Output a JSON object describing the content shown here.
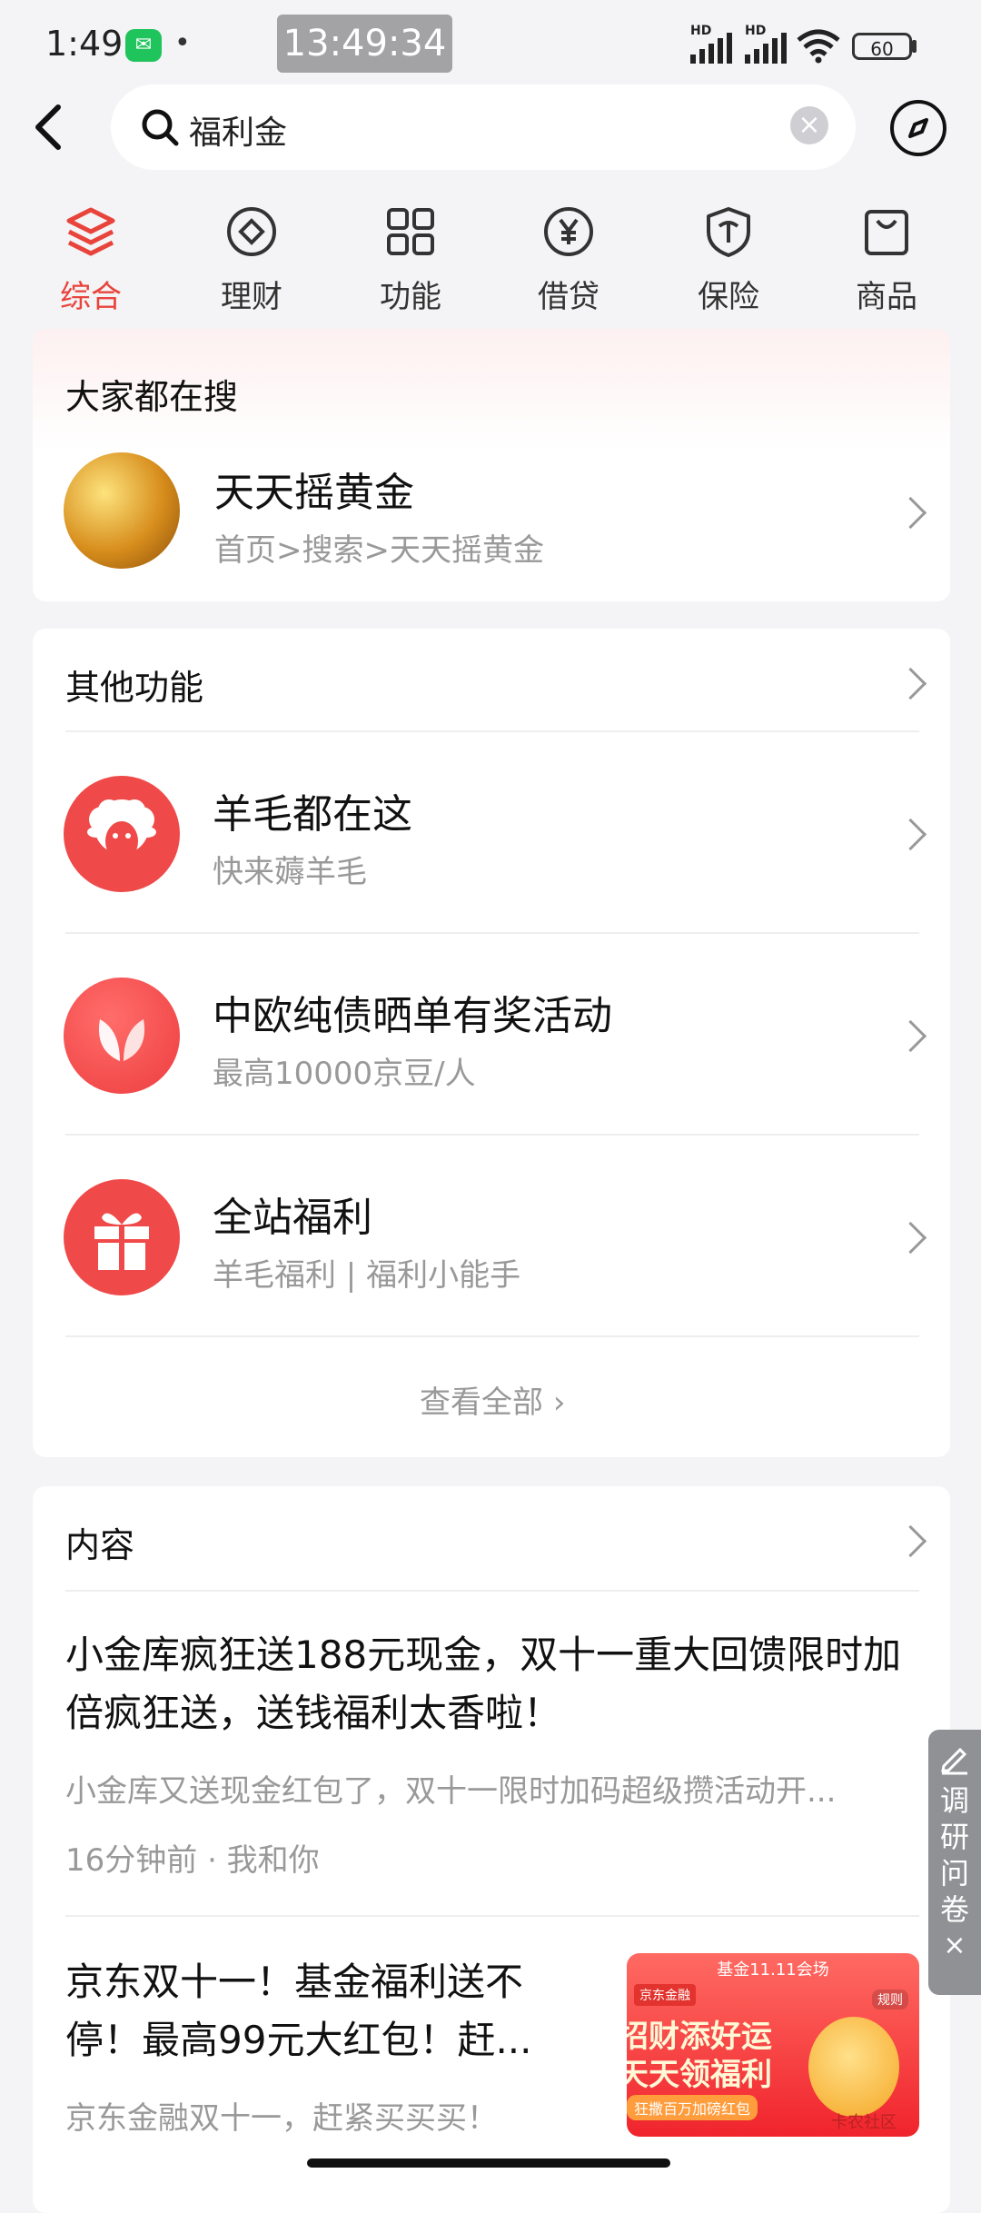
{
  "status": {
    "time": "1:49",
    "center_clock": "13:49:34",
    "battery": "60",
    "hd1": "HD",
    "hd2": "HD"
  },
  "search": {
    "query": "福利金"
  },
  "tabs": [
    {
      "label": "综合",
      "icon": "layers-icon",
      "active": true
    },
    {
      "label": "理财",
      "icon": "diamond-icon",
      "active": false
    },
    {
      "label": "功能",
      "icon": "grid-icon",
      "active": false
    },
    {
      "label": "借贷",
      "icon": "yen-icon",
      "active": false
    },
    {
      "label": "保险",
      "icon": "shield-icon",
      "active": false
    },
    {
      "label": "商品",
      "icon": "bag-icon",
      "active": false
    }
  ],
  "popular": {
    "header": "大家都在搜",
    "item": {
      "title": "天天摇黄金",
      "path": "首页>搜索>天天摇黄金"
    }
  },
  "features": {
    "header": "其他功能",
    "items": [
      {
        "title": "羊毛都在这",
        "sub": "快来薅羊毛",
        "icon": "sheep-icon"
      },
      {
        "title": "中欧纯债晒单有奖活动",
        "sub": "最高10000京豆/人",
        "icon": "leaf-icon"
      },
      {
        "title": "全站福利",
        "sub": "羊毛福利 | 福利小能手",
        "icon": "gift-icon"
      }
    ],
    "view_all": "查看全部"
  },
  "content": {
    "header": "内容",
    "articles": [
      {
        "title": "小金库疯狂送188元现金，双十一重大回馈限时加倍疯狂送，送钱福利太香啦！",
        "summary": "小金库又送现金红包了，双十一限时加码超级攒活动开...",
        "meta": "16分钟前 · 我和你"
      },
      {
        "title": "京东双十一！基金福利送不停！最高99元大红包！赶...",
        "summary": "京东金融双十一，赶紧买买买！"
      }
    ],
    "thumb": {
      "top": "基金11.11会场",
      "brand": "京东金融",
      "line1": "招财添好运",
      "line2": "天天领福利",
      "line3": "狂撒百万加磅红包",
      "rule": "规则",
      "watermark": "卡农社区"
    }
  },
  "survey": {
    "label": "调研问卷",
    "close": "×"
  },
  "colors": {
    "accent": "#e8443c",
    "background": "#f4f4f6"
  }
}
